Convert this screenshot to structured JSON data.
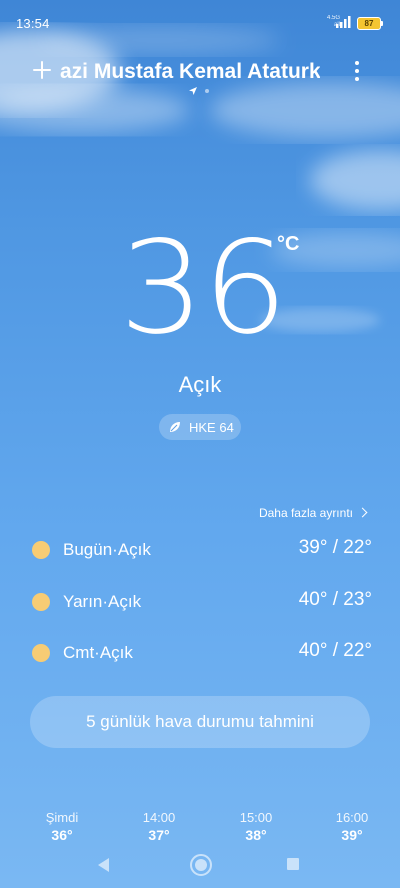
{
  "status_bar": {
    "time": "13:54",
    "network_top": "4.5G",
    "network_bottom": "all",
    "battery": "87"
  },
  "header": {
    "city": "azi Mustafa Kemal Ataturk"
  },
  "current": {
    "temperature": "36",
    "unit": "°C",
    "condition": "Açık",
    "aqi_label": "HKE 64"
  },
  "more_details": "Daha fazla ayrıntı",
  "forecast": [
    {
      "label": "Bugün·Açık",
      "range": "39° / 22°"
    },
    {
      "label": "Yarın·Açık",
      "range": "40° / 23°"
    },
    {
      "label": "Cmt·Açık",
      "range": "40° / 22°"
    }
  ],
  "cta_label": "5 günlük hava durumu tahmini",
  "hourly": [
    {
      "time": "Şimdi",
      "temp": "36°"
    },
    {
      "time": "14:00",
      "temp": "37°"
    },
    {
      "time": "15:00",
      "temp": "38°"
    },
    {
      "time": "16:00",
      "temp": "39°"
    }
  ],
  "colors": {
    "sun": "#f7cc74",
    "battery": "#f4c531"
  }
}
